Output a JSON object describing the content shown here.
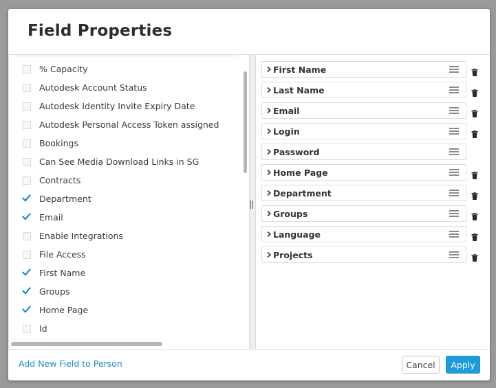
{
  "dialog": {
    "title": "Field Properties"
  },
  "available_fields": [
    {
      "label": "% Capacity",
      "checked": false
    },
    {
      "label": "Autodesk Account Status",
      "checked": false
    },
    {
      "label": "Autodesk Identity Invite Expiry Date",
      "checked": false
    },
    {
      "label": "Autodesk Personal Access Token assigned",
      "checked": false
    },
    {
      "label": "Bookings",
      "checked": false
    },
    {
      "label": "Can See Media Download Links in SG",
      "checked": false
    },
    {
      "label": "Contracts",
      "checked": false
    },
    {
      "label": "Department",
      "checked": true
    },
    {
      "label": "Email",
      "checked": true
    },
    {
      "label": "Enable Integrations",
      "checked": false
    },
    {
      "label": "File Access",
      "checked": false
    },
    {
      "label": "First Name",
      "checked": true
    },
    {
      "label": "Groups",
      "checked": true
    },
    {
      "label": "Home Page",
      "checked": true
    },
    {
      "label": "Id",
      "checked": false
    }
  ],
  "selected_fields": [
    {
      "label": "First Name",
      "deletable": true
    },
    {
      "label": "Last Name",
      "deletable": true
    },
    {
      "label": "Email",
      "deletable": true
    },
    {
      "label": "Login",
      "deletable": true
    },
    {
      "label": "Password",
      "deletable": false
    },
    {
      "label": "Home Page",
      "deletable": true
    },
    {
      "label": "Department",
      "deletable": true
    },
    {
      "label": "Groups",
      "deletable": true
    },
    {
      "label": "Language",
      "deletable": true
    },
    {
      "label": "Projects",
      "deletable": true
    }
  ],
  "footer": {
    "add_field_link": "Add New Field to Person",
    "cancel_label": "Cancel",
    "apply_label": "Apply"
  },
  "colors": {
    "accent": "#1d9bdb",
    "link": "#1a8ac9",
    "checkbox_checked": "#1a8ac9"
  },
  "icons": {
    "expand": "chevron-right-icon",
    "reorder": "drag-handle-icon",
    "delete": "trash-icon",
    "checked": "checkmark-icon"
  }
}
